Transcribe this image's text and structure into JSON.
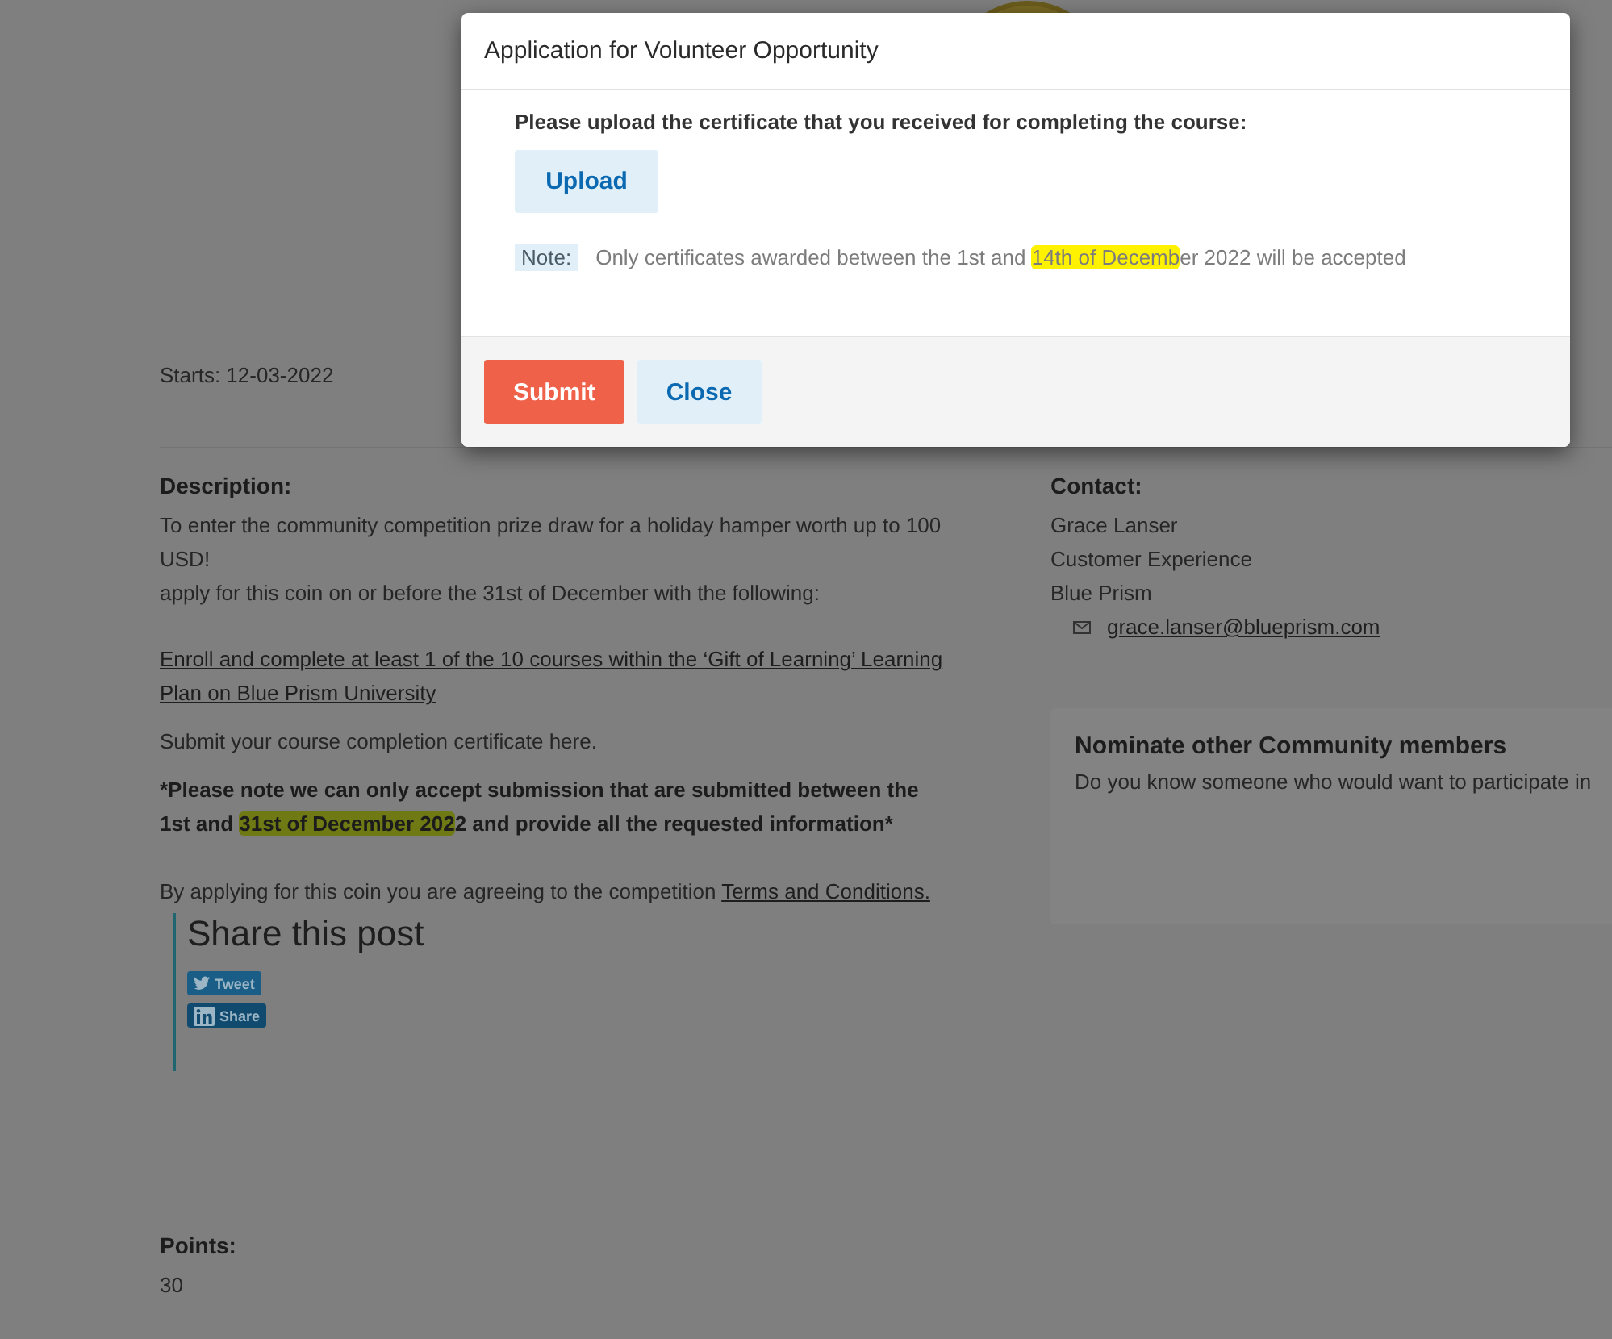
{
  "page": {
    "starts": "Starts: 12-03-2022",
    "description": {
      "heading": "Description:",
      "blocks": [
        {
          "kind": "text",
          "text": "To enter the community competition prize draw for a holiday hamper worth up to 100 USD!"
        },
        {
          "kind": "text",
          "text": "apply for this coin on or before the 31st of December with the following:"
        },
        {
          "kind": "link",
          "text": "Enroll and complete at least 1 of the 10 courses within the ‘Gift of Learning’ Learning Plan on Blue Prism University"
        },
        {
          "kind": "text",
          "text": "Submit your course completion certificate here."
        },
        {
          "kind": "note",
          "segments": [
            {
              "text": "*Please note we can only accept submission that are submitted between the 1st and ",
              "highlighted": false
            },
            {
              "text": "31st of December 202",
              "highlighted": true
            },
            {
              "text": "2 and provide all the requested information*",
              "highlighted": false
            }
          ]
        },
        {
          "kind": "terms",
          "text": "By applying for this coin you are agreeing to the competition ",
          "link": "Terms and Conditions."
        }
      ]
    },
    "share": {
      "heading": "Share this post",
      "buttons": [
        {
          "kind": "twitter",
          "label": "Tweet"
        },
        {
          "kind": "linkedin",
          "label": "Share"
        }
      ]
    },
    "points": {
      "heading": "Points:",
      "value": "30"
    },
    "contact": {
      "heading": "Contact:",
      "lines": [
        "Grace Lanser",
        "Customer Experience",
        "Blue Prism"
      ],
      "email": "grace.lanser@blueprism.com"
    },
    "nominate": {
      "heading": "Nominate other Community members",
      "text": "Do you know someone who would want to participate in"
    }
  },
  "dialog": {
    "title": "Application for Volunteer Opportunity",
    "prompt": "Please upload the certificate that you received for completing the course:",
    "upload": "Upload",
    "note_label": "Note:",
    "note_segments": [
      {
        "text": "Only certificates awarded between the 1st and ",
        "highlighted": false
      },
      {
        "text": "14th of Decemb",
        "highlighted": true
      },
      {
        "text": "er 2022 will be accepted",
        "highlighted": false
      }
    ],
    "buttons": [
      {
        "kind": "primary",
        "label": "Submit"
      },
      {
        "kind": "secondary",
        "label": "Close"
      }
    ]
  }
}
